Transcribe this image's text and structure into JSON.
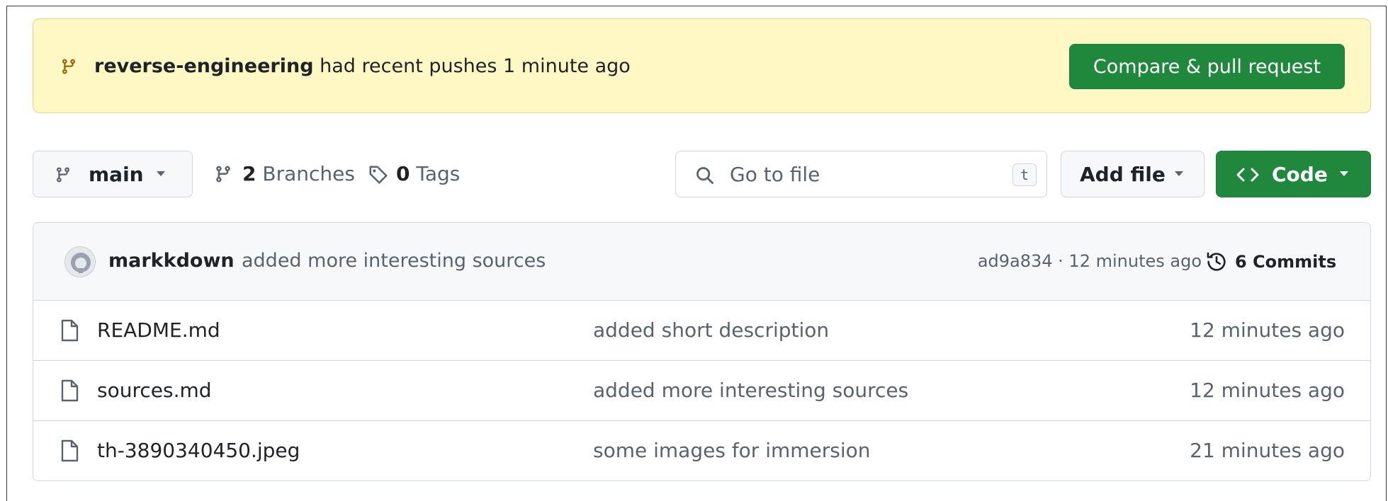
{
  "banner": {
    "branch": "reverse-engineering",
    "message": "had recent pushes 1 minute ago",
    "button": "Compare & pull request",
    "icon": "git-branch-icon"
  },
  "toolbar": {
    "branch": "main",
    "branches_count": "2",
    "branches_label": "Branches",
    "tags_count": "0",
    "tags_label": "Tags",
    "search_placeholder": "Go to file",
    "search_shortcut": "t",
    "add_file": "Add file",
    "code": "Code"
  },
  "commit": {
    "author": "markkdown",
    "message": "added more interesting sources",
    "meta": "ad9a834 · 12 minutes ago",
    "commits": "6 Commits"
  },
  "files": [
    {
      "name": "README.md",
      "message": "added short description",
      "time": "12 minutes ago"
    },
    {
      "name": "sources.md",
      "message": "added more interesting sources",
      "time": "12 minutes ago"
    },
    {
      "name": "th-3890340450.jpeg",
      "message": "some images for immersion",
      "time": "21 minutes ago"
    }
  ],
  "colors": {
    "primary": "#1f883d",
    "banner_bg": "#fff8c5",
    "muted_text": "#59636e",
    "border": "#d0d7de"
  }
}
